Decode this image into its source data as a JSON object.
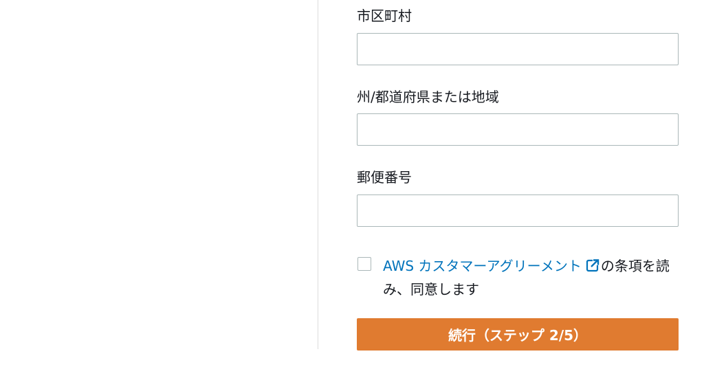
{
  "form": {
    "city": {
      "label": "市区町村",
      "value": "",
      "placeholder": ""
    },
    "state": {
      "label": "州/都道府県または地域",
      "value": "",
      "placeholder": ""
    },
    "postal": {
      "label": "郵便番号",
      "value": "",
      "placeholder": ""
    },
    "agreement": {
      "checked": false,
      "link_text": "AWS カスタマーアグリーメント",
      "link_icon": "external-link-icon",
      "suffix_text": "の条項を読み、同意します"
    },
    "continue_label": "続行（ステップ 2/5）"
  },
  "colors": {
    "link": "#0073bb",
    "button_bg": "#e07b30",
    "input_border": "#aab7b8"
  }
}
